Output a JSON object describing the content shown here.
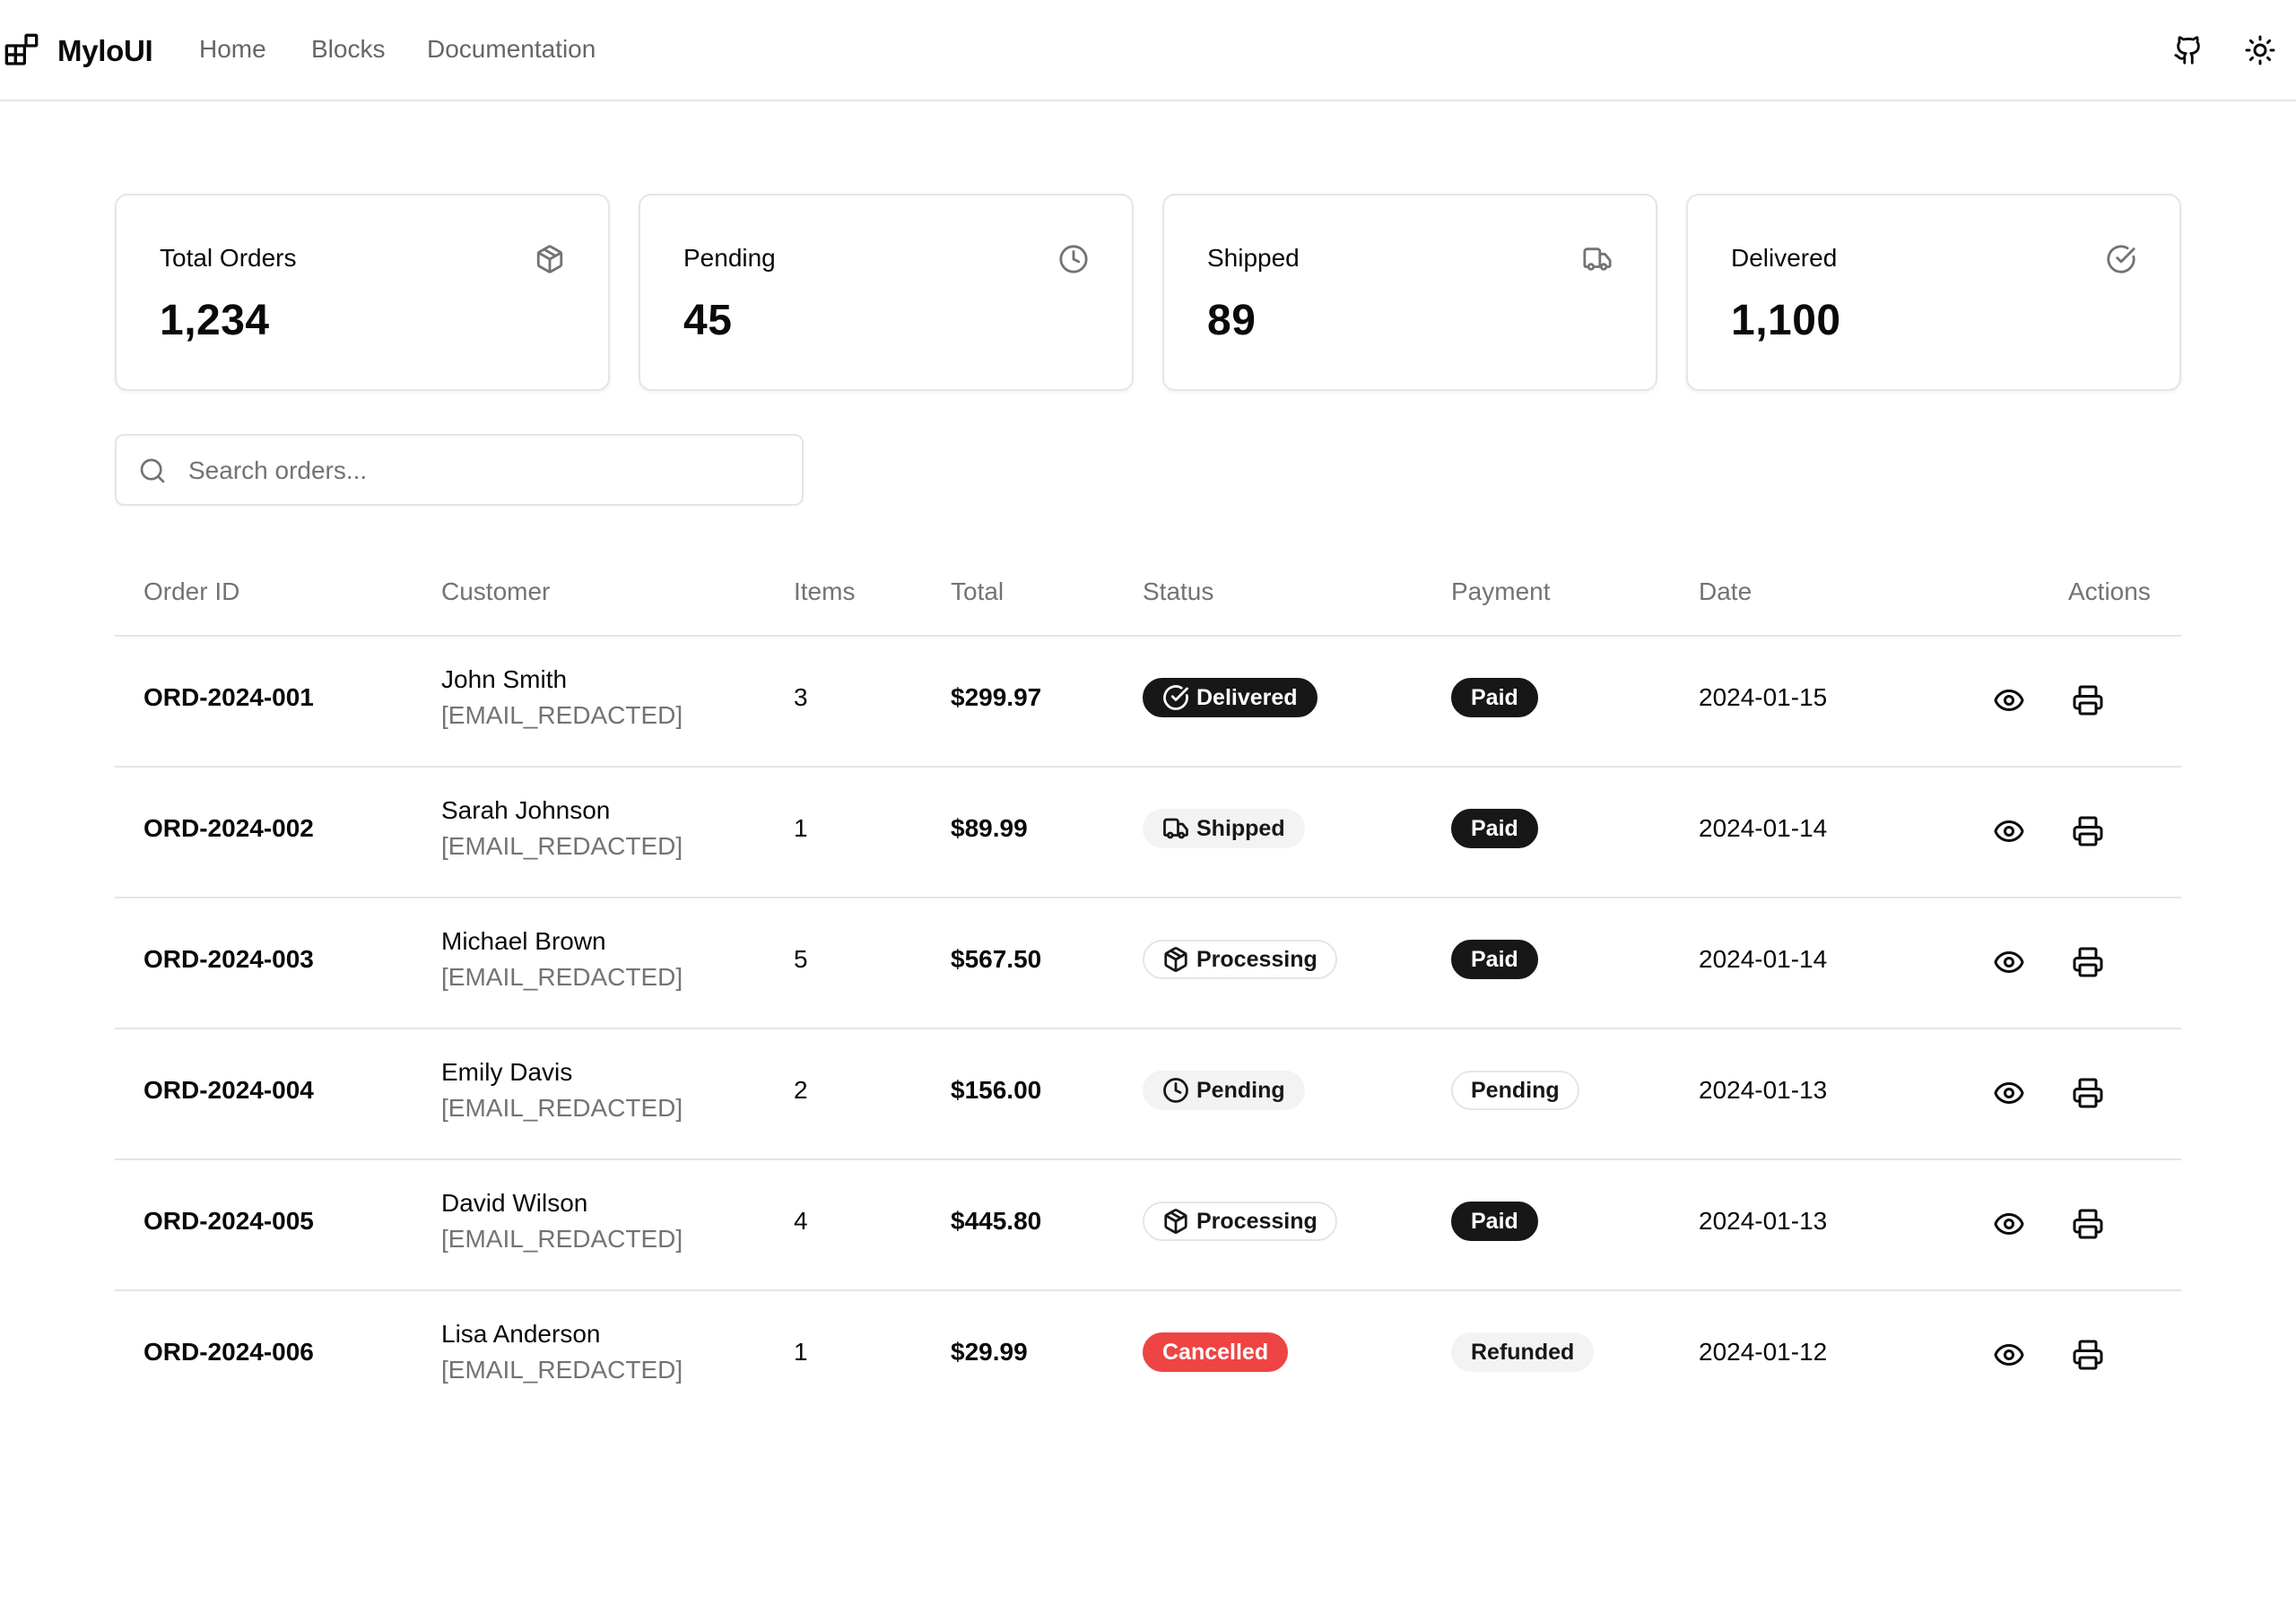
{
  "header": {
    "brand": "MyloUI",
    "nav": [
      "Home",
      "Blocks",
      "Documentation"
    ],
    "icons": [
      "github-icon",
      "sun-icon"
    ]
  },
  "stats": [
    {
      "label": "Total Orders",
      "value": "1,234",
      "icon": "package-icon"
    },
    {
      "label": "Pending",
      "value": "45",
      "icon": "clock-icon"
    },
    {
      "label": "Shipped",
      "value": "89",
      "icon": "truck-icon"
    },
    {
      "label": "Delivered",
      "value": "1,100",
      "icon": "check-circle-icon"
    }
  ],
  "search": {
    "placeholder": "Search orders..."
  },
  "table": {
    "headers": [
      "Order ID",
      "Customer",
      "Items",
      "Total",
      "Status",
      "Payment",
      "Date",
      "Actions"
    ],
    "rows": [
      {
        "id": "ORD-2024-001",
        "name": "John Smith",
        "email": "[EMAIL_REDACTED]",
        "items": "3",
        "total": "$299.97",
        "status": "Delivered",
        "payment": "Paid",
        "date": "2024-01-15"
      },
      {
        "id": "ORD-2024-002",
        "name": "Sarah Johnson",
        "email": "[EMAIL_REDACTED]",
        "items": "1",
        "total": "$89.99",
        "status": "Shipped",
        "payment": "Paid",
        "date": "2024-01-14"
      },
      {
        "id": "ORD-2024-003",
        "name": "Michael Brown",
        "email": "[EMAIL_REDACTED]",
        "items": "5",
        "total": "$567.50",
        "status": "Processing",
        "payment": "Paid",
        "date": "2024-01-14"
      },
      {
        "id": "ORD-2024-004",
        "name": "Emily Davis",
        "email": "[EMAIL_REDACTED]",
        "items": "2",
        "total": "$156.00",
        "status": "Pending",
        "payment": "Pending",
        "date": "2024-01-13"
      },
      {
        "id": "ORD-2024-005",
        "name": "David Wilson",
        "email": "[EMAIL_REDACTED]",
        "items": "4",
        "total": "$445.80",
        "status": "Processing",
        "payment": "Paid",
        "date": "2024-01-13"
      },
      {
        "id": "ORD-2024-006",
        "name": "Lisa Anderson",
        "email": "[EMAIL_REDACTED]",
        "items": "1",
        "total": "$29.99",
        "status": "Cancelled",
        "payment": "Refunded",
        "date": "2024-01-12"
      }
    ]
  },
  "colors": {
    "primary": "#171717",
    "muted": "#737373",
    "border": "#e5e5e5",
    "danger": "#ef4444"
  }
}
